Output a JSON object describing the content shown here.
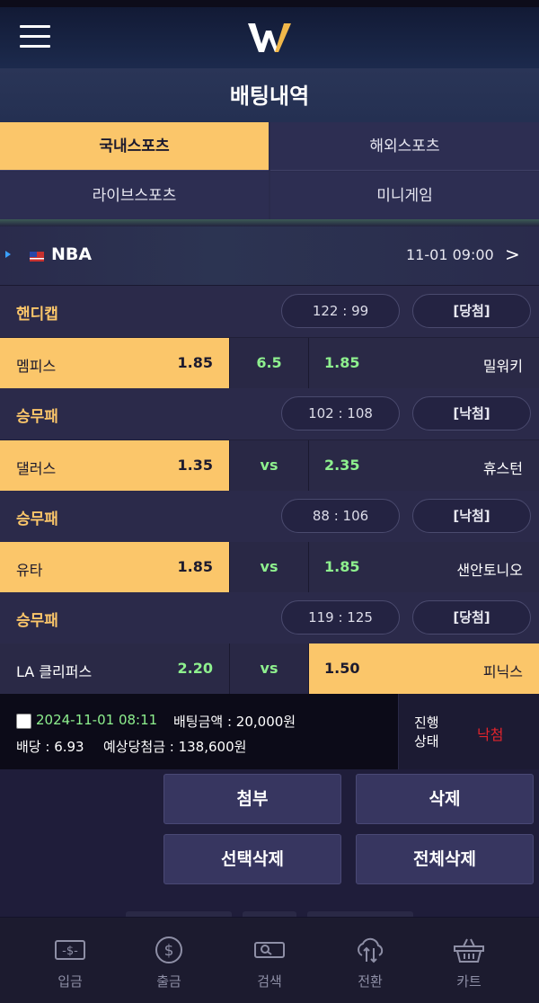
{
  "header": {
    "menu_icon": "hamburger-icon",
    "logo_icon": "w-logo-icon"
  },
  "page_title": "배팅내역",
  "tabs": [
    {
      "label": "국내스포츠",
      "active": true
    },
    {
      "label": "해외스포츠",
      "active": false
    },
    {
      "label": "라이브스포츠",
      "active": false
    },
    {
      "label": "미니게임",
      "active": false
    }
  ],
  "league": {
    "name": "NBA",
    "datetime": "11-01 09:00",
    "chevron": ">"
  },
  "bets": [
    {
      "bet_type": "핸디캡",
      "score": "122 : 99",
      "result": "[당첨]",
      "home_team": "멤피스",
      "home_odds": "1.85",
      "middle": "6.5",
      "away_team": "밀워키",
      "away_odds": "1.85",
      "selected": "home"
    },
    {
      "bet_type": "승무패",
      "score": "102 : 108",
      "result": "[낙첨]",
      "home_team": "댈러스",
      "home_odds": "1.35",
      "middle": "vs",
      "away_team": "휴스턴",
      "away_odds": "2.35",
      "selected": "home"
    },
    {
      "bet_type": "승무패",
      "score": "88 : 106",
      "result": "[낙첨]",
      "home_team": "유타",
      "home_odds": "1.85",
      "middle": "vs",
      "away_team": "샌안토니오",
      "away_odds": "1.85",
      "selected": "home"
    },
    {
      "bet_type": "승무패",
      "score": "119 : 125",
      "result": "[당첨]",
      "home_team": "LA 클리퍼스",
      "home_odds": "2.20",
      "middle": "vs",
      "away_team": "피닉스",
      "away_odds": "1.50",
      "selected": "away"
    }
  ],
  "summary": {
    "date": "2024-11-01 08:11",
    "bet_amount": "배팅금액 : 20,000원",
    "odds": "배당 : 6.93",
    "expected_win": "예상당첨금 : 138,600원",
    "status_label": "진행 상태",
    "status_value": "낙첨"
  },
  "buttons": {
    "attach": "첨부",
    "delete": "삭제",
    "delete_selected": "선택삭제",
    "delete_all": "전체삭제"
  },
  "bottom_nav": [
    {
      "label": "입금",
      "icon": "deposit-icon"
    },
    {
      "label": "출금",
      "icon": "dollar-coin-icon"
    },
    {
      "label": "검색",
      "icon": "search-card-icon"
    },
    {
      "label": "전환",
      "icon": "cloud-transfer-icon"
    },
    {
      "label": "카트",
      "icon": "basket-icon"
    }
  ],
  "colors": {
    "accent": "#fbc66a",
    "odds_green": "#8ef08e",
    "loss_red": "#e0242c",
    "background": "#1f1d3a"
  }
}
